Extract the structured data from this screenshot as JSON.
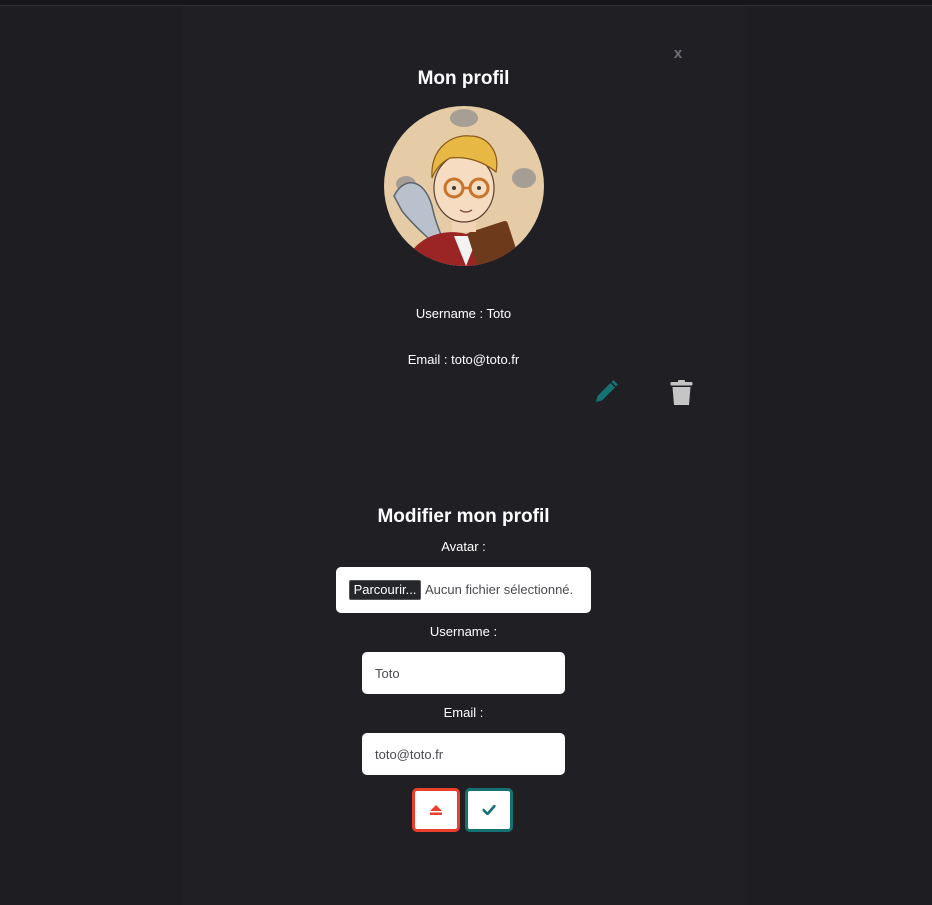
{
  "profile": {
    "title": "Mon profil",
    "close_label": "x",
    "username_line": "Username : Toto",
    "email_line": "Email : toto@toto.fr"
  },
  "icons": {
    "close": "close-icon",
    "avatar": "avatar-image",
    "edit": "pencil-icon",
    "delete": "trash-icon",
    "cancel": "eject-icon",
    "confirm": "check-icon"
  },
  "edit_form": {
    "title": "Modifier mon profil",
    "avatar_label": "Avatar :",
    "browse_label": "Parcourir...",
    "no_file_text": "Aucun fichier sélectionné.",
    "username_label": "Username :",
    "username_value": "Toto",
    "email_label": "Email :",
    "email_value": "toto@toto.fr"
  },
  "colors": {
    "background": "#1d1d22",
    "accent_teal": "#157273",
    "cancel_red": "#ea3f2c",
    "muted_gray": "#c5c5c5"
  }
}
